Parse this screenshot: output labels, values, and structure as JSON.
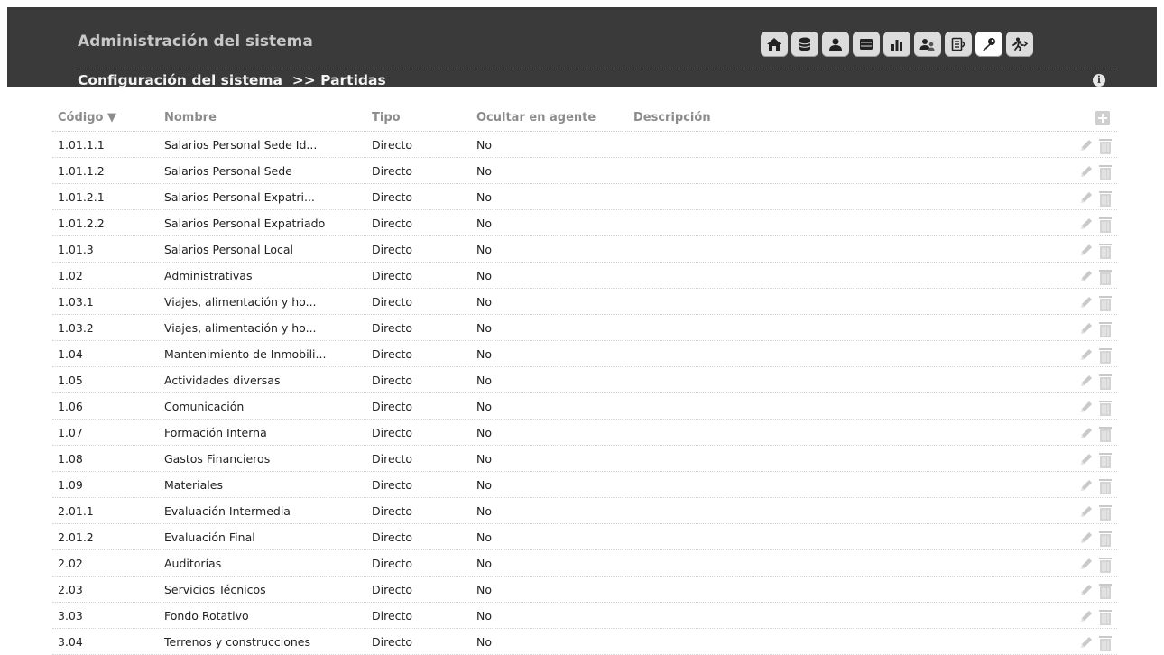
{
  "header": {
    "app_title": "Administración del sistema",
    "breadcrumb": "Configuración del sistema  >> Partidas"
  },
  "toolbar": [
    {
      "icon": "home-icon"
    },
    {
      "icon": "database-icon"
    },
    {
      "icon": "user-icon"
    },
    {
      "icon": "folder-icon"
    },
    {
      "icon": "bar-chart-icon"
    },
    {
      "icon": "users-icon"
    },
    {
      "icon": "list-icon"
    },
    {
      "icon": "key-icon",
      "active": true
    },
    {
      "icon": "logout-icon"
    }
  ],
  "table": {
    "columns": {
      "code": "Código ▼",
      "name": "Nombre",
      "type": "Tipo",
      "hide": "Ocultar en agente",
      "desc": "Descripción"
    },
    "rows": [
      {
        "code": "1.01.1.1",
        "name": "Salarios Personal Sede Id...",
        "type": "Directo",
        "hide": "No",
        "desc": ""
      },
      {
        "code": "1.01.1.2",
        "name": "Salarios Personal Sede",
        "type": "Directo",
        "hide": "No",
        "desc": ""
      },
      {
        "code": "1.01.2.1",
        "name": "Salarios Personal Expatri...",
        "type": "Directo",
        "hide": "No",
        "desc": ""
      },
      {
        "code": "1.01.2.2",
        "name": "Salarios Personal Expatriado",
        "type": "Directo",
        "hide": "No",
        "desc": ""
      },
      {
        "code": "1.01.3",
        "name": "Salarios Personal Local",
        "type": "Directo",
        "hide": "No",
        "desc": ""
      },
      {
        "code": "1.02",
        "name": "Administrativas",
        "type": "Directo",
        "hide": "No",
        "desc": ""
      },
      {
        "code": "1.03.1",
        "name": "Viajes, alimentación y ho...",
        "type": "Directo",
        "hide": "No",
        "desc": ""
      },
      {
        "code": "1.03.2",
        "name": "Viajes, alimentación y ho...",
        "type": "Directo",
        "hide": "No",
        "desc": ""
      },
      {
        "code": "1.04",
        "name": "Mantenimiento de Inmobili...",
        "type": "Directo",
        "hide": "No",
        "desc": ""
      },
      {
        "code": "1.05",
        "name": "Actividades diversas",
        "type": "Directo",
        "hide": "No",
        "desc": ""
      },
      {
        "code": "1.06",
        "name": "Comunicación",
        "type": "Directo",
        "hide": "No",
        "desc": ""
      },
      {
        "code": "1.07",
        "name": "Formación Interna",
        "type": "Directo",
        "hide": "No",
        "desc": ""
      },
      {
        "code": "1.08",
        "name": "Gastos Financieros",
        "type": "Directo",
        "hide": "No",
        "desc": ""
      },
      {
        "code": "1.09",
        "name": "Materiales",
        "type": "Directo",
        "hide": "No",
        "desc": ""
      },
      {
        "code": "2.01.1",
        "name": "Evaluación Intermedia",
        "type": "Directo",
        "hide": "No",
        "desc": ""
      },
      {
        "code": "2.01.2",
        "name": "Evaluación Final",
        "type": "Directo",
        "hide": "No",
        "desc": ""
      },
      {
        "code": "2.02",
        "name": "Auditorías",
        "type": "Directo",
        "hide": "No",
        "desc": ""
      },
      {
        "code": "2.03",
        "name": "Servicios Técnicos",
        "type": "Directo",
        "hide": "No",
        "desc": ""
      },
      {
        "code": "3.03",
        "name": "Fondo Rotativo",
        "type": "Directo",
        "hide": "No",
        "desc": ""
      },
      {
        "code": "3.04",
        "name": "Terrenos y construcciones",
        "type": "Directo",
        "hide": "No",
        "desc": ""
      }
    ]
  }
}
